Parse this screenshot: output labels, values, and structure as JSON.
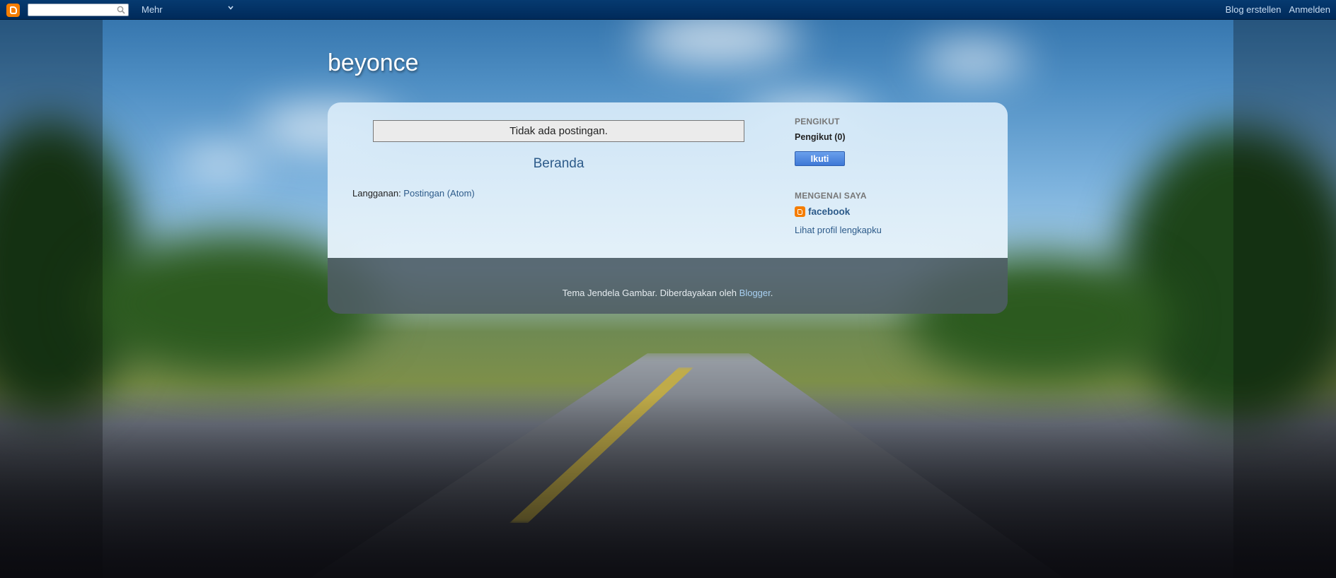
{
  "navbar": {
    "search": {
      "value": "",
      "placeholder": ""
    },
    "more_label": "Mehr",
    "create_blog_label": "Blog erstellen",
    "sign_in_label": "Anmelden"
  },
  "blog": {
    "title": "beyonce"
  },
  "main": {
    "no_posts_text": "Tidak ada postingan.",
    "home_link": "Beranda",
    "subscribe_label": "Langganan: ",
    "subscribe_link": "Postingan (Atom)"
  },
  "sidebar": {
    "followers": {
      "title": "PENGIKUT",
      "count_label": "Pengikut (0)",
      "follow_button": "Ikuti"
    },
    "about": {
      "title": "MENGENAI SAYA",
      "profile_name": "facebook",
      "full_profile_link": "Lihat profil lengkapku"
    }
  },
  "footer": {
    "attribution_text": "Tema Jendela Gambar. Diberdayakan oleh ",
    "blogger_link": "Blogger",
    "period": "."
  },
  "colors": {
    "navbar": "#002a5a",
    "link": "#2d5b8a",
    "blogger_orange": "#f57d00",
    "follow_button": "#4a84e0"
  },
  "icons": {
    "logo": "blogger-logo-icon",
    "search": "search-icon",
    "chevron": "chevron-down-icon",
    "profile": "blogger-profile-icon"
  }
}
